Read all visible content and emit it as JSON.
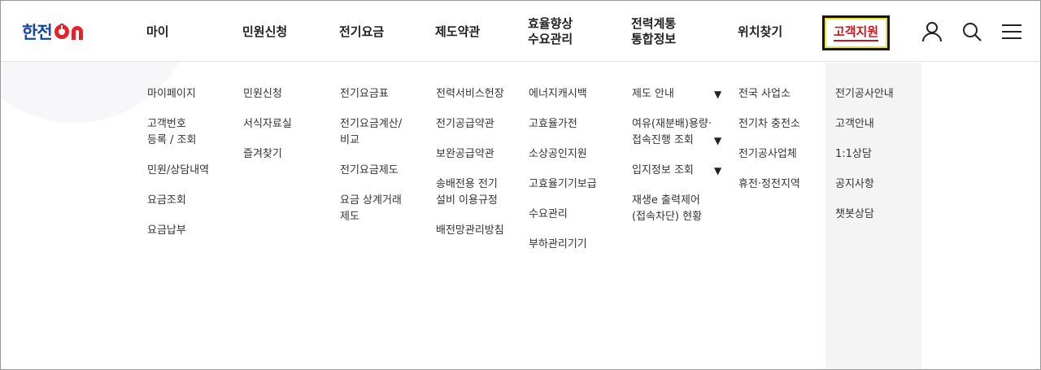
{
  "header": {
    "logo": {
      "text": "한전",
      "on": "on"
    },
    "gnb": [
      {
        "label": "마이",
        "name": "gnb-my"
      },
      {
        "label": "민원신청",
        "name": "gnb-civil"
      },
      {
        "label": "전기요금",
        "name": "gnb-fee"
      },
      {
        "label": "제도약관",
        "name": "gnb-terms"
      },
      {
        "label": "효율향상\n수요관리",
        "name": "gnb-efficiency"
      },
      {
        "label": "전력계통\n통합정보",
        "name": "gnb-grid"
      },
      {
        "label": "위치찾기",
        "name": "gnb-location"
      },
      {
        "label": "고객지원",
        "name": "gnb-support"
      }
    ],
    "icons": [
      "user-icon",
      "search-icon",
      "menu-icon"
    ]
  },
  "menu": {
    "my": [
      "마이페이지",
      "고객번호\n등록 / 조회",
      "민원/상담내역",
      "요금조회",
      "요금납부"
    ],
    "civil": [
      "민원신청",
      "서식자료실",
      "즐겨찾기"
    ],
    "fee": [
      "전기요금표",
      "전기요금계산/\n비교",
      "전기요금제도",
      "요금 상계거래\n제도"
    ],
    "terms": [
      "전력서비스헌장",
      "전기공급약관",
      "보완공급약관",
      "송배전용 전기\n설비 이용규정",
      "배전망관리방침"
    ],
    "efficiency": [
      "에너지캐시백",
      "고효율가전",
      "소상공인지원",
      "고효율기기보급",
      "수요관리",
      "부하관리기기"
    ],
    "grid": [
      "제도 안내",
      "여유(재분배)용량·\n접속진행 조회",
      "입지정보 조회",
      "재생e 출력제어\n(접속차단) 현황"
    ],
    "location": [
      "전국 사업소",
      "전기차 충전소",
      "전기공사업체",
      "휴전·정전지역"
    ],
    "support": [
      "전기공사안내",
      "고객안내",
      "1:1상담",
      "공지사항",
      "챗봇상담"
    ]
  },
  "colors": {
    "brand_blue": "#1747a6",
    "brand_red": "#e8202a",
    "active_red": "#d0121b",
    "focus_yellow": "#f4e61c"
  }
}
